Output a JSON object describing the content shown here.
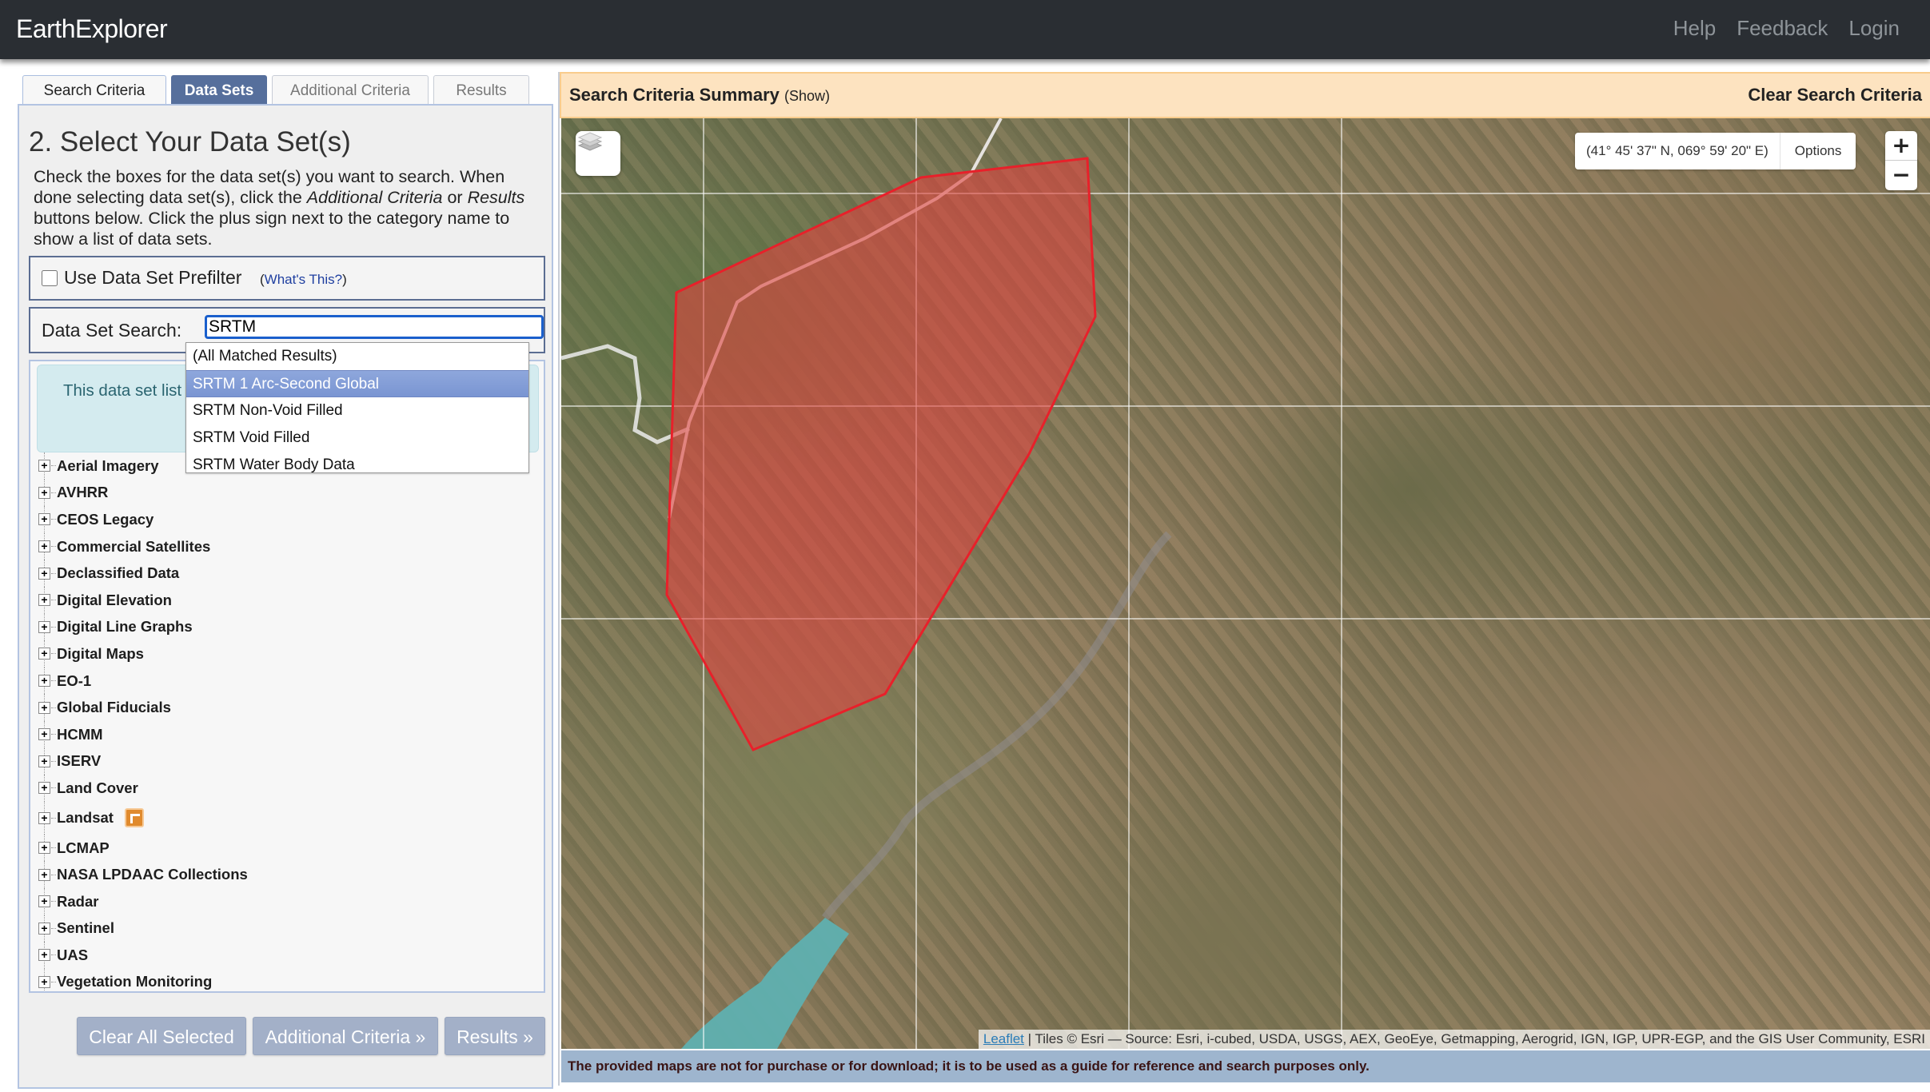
{
  "header": {
    "brand": "EarthExplorer",
    "nav": [
      "Help",
      "Feedback",
      "Login"
    ]
  },
  "tabs": [
    {
      "label": "Search Criteria",
      "active": false
    },
    {
      "label": "Data Sets",
      "active": true
    },
    {
      "label": "Additional Criteria",
      "active": false
    },
    {
      "label": "Results",
      "active": false
    }
  ],
  "left": {
    "title": "2. Select Your Data Set(s)",
    "intro_1": "Check the boxes for the data set(s) you want to search. When done selecting data set(s), click the ",
    "intro_em1": "Additional Criteria",
    "intro_2": " or ",
    "intro_em2": "Results",
    "intro_3": " buttons below. Click the plus sign next to the category name to show a list of data sets.",
    "prefilter": {
      "label": "Use Data Set Prefilter",
      "checked": false,
      "help_open": "(",
      "help_link": "What's This?",
      "help_close": ")"
    },
    "search": {
      "label": "Data Set Search:",
      "value": "SRTM"
    },
    "dropdown": [
      {
        "label": "(All Matched Results)",
        "highlighted": false
      },
      {
        "label": "SRTM 1 Arc-Second Global",
        "highlighted": true
      },
      {
        "label": "SRTM Non-Void Filled",
        "highlighted": false
      },
      {
        "label": "SRTM Void Filled",
        "highlighted": false
      },
      {
        "label": "SRTM Water Body Data",
        "highlighted": false
      }
    ],
    "notice": "This data set list permissions have expected dataset",
    "categories": [
      "Aerial Imagery",
      "AVHRR",
      "CEOS Legacy",
      "Commercial Satellites",
      "Declassified Data",
      "Digital Elevation",
      "Digital Line Graphs",
      "Digital Maps",
      "EO-1",
      "Global Fiducials",
      "HCMM",
      "ISERV",
      "Land Cover",
      "Landsat",
      "LCMAP",
      "NASA LPDAAC Collections",
      "Radar",
      "Sentinel",
      "UAS",
      "Vegetation Monitoring"
    ],
    "buttons": {
      "clear": "Clear All Selected",
      "additional": "Additional Criteria »",
      "results": "Results »"
    }
  },
  "map": {
    "summary_title": "Search Criteria Summary",
    "summary_toggle": "(Show)",
    "clear_label": "Clear Search Criteria",
    "coordinates": "(41° 45' 37\" N, 069° 59' 20\" E)",
    "options_label": "Options",
    "zoom_in": "+",
    "zoom_out": "−",
    "attribution_link": "Leaflet",
    "attribution_text": " | Tiles © Esri — Source: Esri, i-cubed, USDA, USGS, AEX, GeoEye, Getmapping, Aerogrid, IGN, IGP, UPR-EGP, and the GIS User Community, ESRI",
    "disclaimer": "The provided maps are not for purchase or for download; it is to be used as a guide for reference and search purposes only.",
    "colors": {
      "polygon_stroke": "#e8202a",
      "polygon_fill": "#e0453f",
      "water": "#5fb0b0"
    }
  }
}
